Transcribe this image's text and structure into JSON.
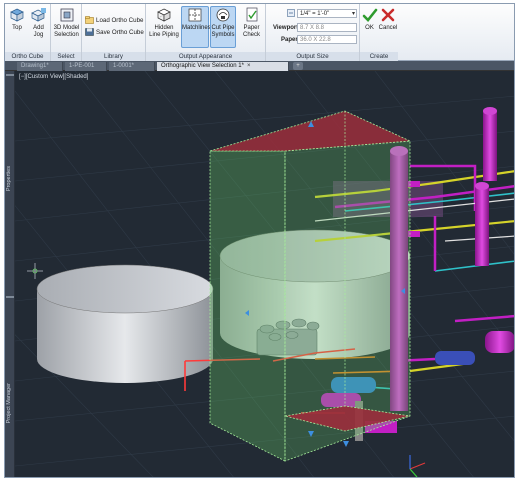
{
  "ribbon": {
    "panels": {
      "ortho_cube": "Ortho Cube",
      "select": "Select",
      "library": "Library",
      "output_appearance": "Output Appearance",
      "output_size": "Output Size",
      "create": "Create"
    },
    "buttons": {
      "top": "Top",
      "add_jog": "Add Jog",
      "model_selection": "3D Model Selection",
      "load_ortho_cube": "Load Ortho Cube",
      "save_ortho_cube": "Save Ortho Cube",
      "hidden_line_piping": "Hidden Line Piping",
      "matchlines": "Matchlines",
      "cut_pipe_symbols": "Cut Pipe Symbols",
      "paper_check": "Paper Check",
      "ok": "OK",
      "cancel": "Cancel"
    },
    "output_size": {
      "scale_value": "1/4\" = 1'-0\"",
      "viewport_label": "Viewport:",
      "viewport_value": "8.7 X 8.8",
      "paper_label": "Paper:",
      "paper_value": "36.0 X 22.8"
    }
  },
  "tabs": [
    {
      "label": "Drawing1*",
      "active": false
    },
    {
      "label": "1-PE-001",
      "active": false
    },
    {
      "label": "1-0001*",
      "active": false
    },
    {
      "label": "Orthographic View Selection 1*",
      "active": true
    }
  ],
  "tab_close_glyph": "×",
  "tab_new_glyph": "+",
  "side_palettes": {
    "properties": "Properties",
    "project_manager": "Project Manager"
  },
  "viewport": {
    "label": "[−][Custom View][Shaded]"
  },
  "colors": {
    "ribbon_bg": "#e6ebf2",
    "viewport_bg": "#222a34",
    "selection_box": "#7bdc7b",
    "pipe_magenta": "#c21fc4",
    "ok_green": "#2e9b2e",
    "cancel_red": "#c92b2b"
  },
  "icons": [
    "cube-top-icon",
    "add-jog-icon",
    "model-selection-icon",
    "load-icon",
    "save-icon",
    "hidden-line-icon",
    "matchlines-icon",
    "cut-pipe-icon",
    "paper-check-icon",
    "scale-icon",
    "ok-check-icon",
    "cancel-x-icon",
    "ucs-icon"
  ]
}
